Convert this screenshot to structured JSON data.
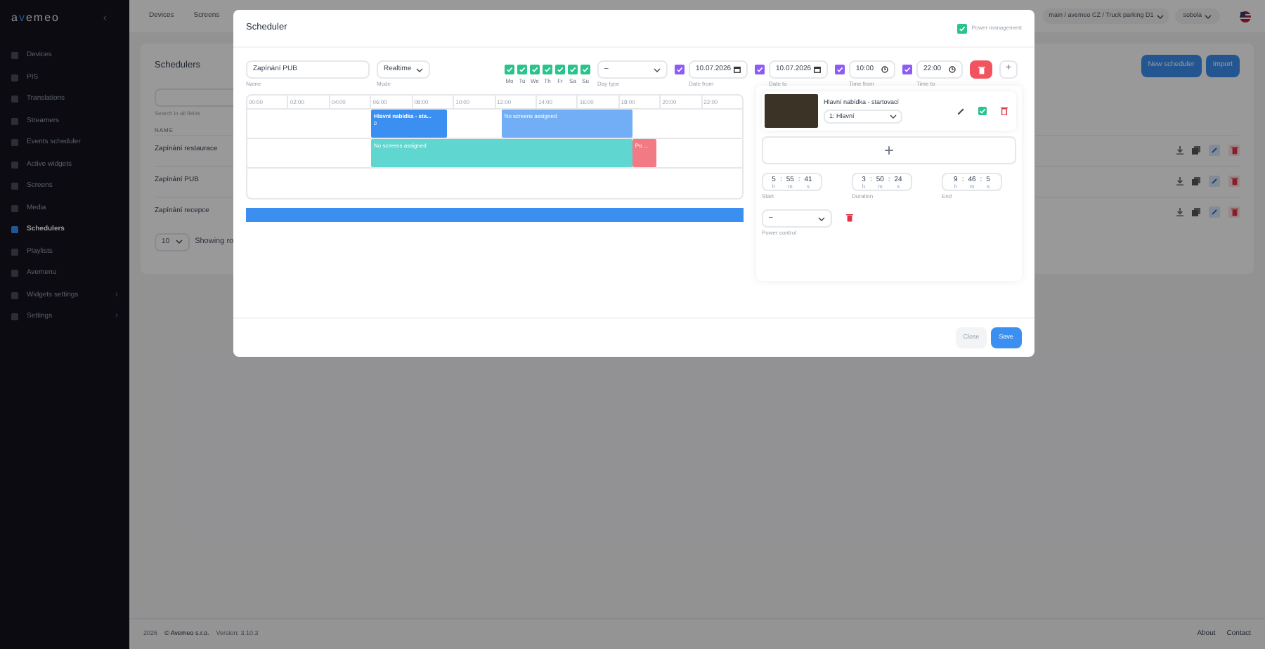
{
  "sidebar": {
    "logo": {
      "before": "a",
      "accent": "v",
      "after": "emeo"
    },
    "collapse": "‹",
    "items": [
      {
        "label": "Devices",
        "selected": false
      },
      {
        "label": "PIS",
        "selected": false
      },
      {
        "label": "Translations",
        "selected": false
      },
      {
        "label": "Streamers",
        "selected": false
      },
      {
        "label": "Events scheduler",
        "selected": false
      },
      {
        "label": "Active widgets",
        "selected": false
      },
      {
        "label": "Screens",
        "selected": false
      },
      {
        "label": "Media",
        "selected": false
      },
      {
        "label": "Schedulers",
        "selected": true
      },
      {
        "label": "Playlists",
        "selected": false
      },
      {
        "label": "Avemenu",
        "selected": false
      },
      {
        "label": "Widgets settings",
        "selected": false,
        "arrow": "›"
      },
      {
        "label": "Settings",
        "selected": false,
        "arrow": "›"
      }
    ]
  },
  "topbar": {
    "tabs": [
      "Devices",
      "Screens"
    ],
    "breadcrumb": "main / avemeo CZ / Truck parking D1",
    "user": "sobola"
  },
  "page": {
    "title": "Schedulers",
    "buttons": [
      "New scheduler",
      "Import"
    ],
    "search_hint": "Search in all fields",
    "column": "NAME",
    "rows": [
      "Zapínání restaurace",
      "Zapínání PUB",
      "Zapínání recepce"
    ],
    "page_size": "10",
    "showing": "Showing ro"
  },
  "footer": {
    "year": "2026",
    "company": "© Avemeo s.r.o.",
    "version": "Version: 3.10.3",
    "links": [
      "About",
      "Contact"
    ]
  },
  "modal": {
    "title": "Scheduler",
    "power_management": {
      "label": "Power management",
      "checked": true
    },
    "name": {
      "value": "Zapínání PUB",
      "label": "Name"
    },
    "mode": {
      "value": "Realtime",
      "label": "Mode"
    },
    "days": [
      {
        "label": "Mo",
        "checked": true
      },
      {
        "label": "Tu",
        "checked": true
      },
      {
        "label": "We",
        "checked": true
      },
      {
        "label": "Th",
        "checked": true
      },
      {
        "label": "Fr",
        "checked": true
      },
      {
        "label": "Sa",
        "checked": true
      },
      {
        "label": "Su",
        "checked": true
      }
    ],
    "day_type": {
      "value": "–",
      "label": "Day type"
    },
    "ranges": [
      {
        "kind": "date",
        "value": "10.07.2026",
        "label": "Date from",
        "checked": true
      },
      {
        "kind": "date",
        "value": "10.07.2026",
        "label": "Date to",
        "checked": true
      },
      {
        "kind": "time",
        "value": "10:00",
        "label": "Time from",
        "checked": true
      },
      {
        "kind": "time",
        "value": "22:00",
        "label": "Time to",
        "checked": true
      }
    ],
    "add": "+",
    "timeline": {
      "ticks": [
        "00:00",
        "02:00",
        "04:00",
        "06:00",
        "08:00",
        "10:00",
        "12:00",
        "14:00",
        "16:00",
        "18:00",
        "20:00",
        "22:00"
      ],
      "rows": [
        {
          "blocks": [
            {
              "title": "Hlavní nabídka - sta...",
              "sub": "0",
              "color": "#3b8ff0"
            },
            {
              "title": "No screens assigned",
              "color": "#72aef5"
            }
          ]
        },
        {
          "blocks": [
            {
              "title": "No screens assigned",
              "color": "#5fd6cf"
            },
            {
              "title": "Po ...",
              "color": "#f27a85"
            }
          ]
        },
        {}
      ]
    },
    "timeline_bar": {
      "level": 1
    },
    "item": {
      "title": "Hlavní nabídka - startovací",
      "screen": "1: Hlavní",
      "add": "+",
      "times": [
        {
          "label": "Start",
          "parts": [
            {
              "value": "5",
              "unit": "h"
            },
            {
              "sep": ":",
              "value": "55",
              "unit": "m"
            },
            {
              "sep": ":",
              "value": "41",
              "unit": "s"
            }
          ]
        },
        {
          "label": "Duration",
          "parts": [
            {
              "value": "3",
              "unit": "h"
            },
            {
              "sep": ":",
              "value": "50",
              "unit": "m"
            },
            {
              "sep": ":",
              "value": "24",
              "unit": "s"
            }
          ]
        },
        {
          "label": "End",
          "parts": [
            {
              "value": "9",
              "unit": "h"
            },
            {
              "sep": ":",
              "value": "46",
              "unit": "m"
            },
            {
              "sep": ":",
              "value": "5",
              "unit": "s"
            }
          ]
        }
      ],
      "power_control": {
        "value": "–",
        "label": "Power control"
      }
    },
    "buttons": [
      "Close",
      "Save"
    ]
  }
}
